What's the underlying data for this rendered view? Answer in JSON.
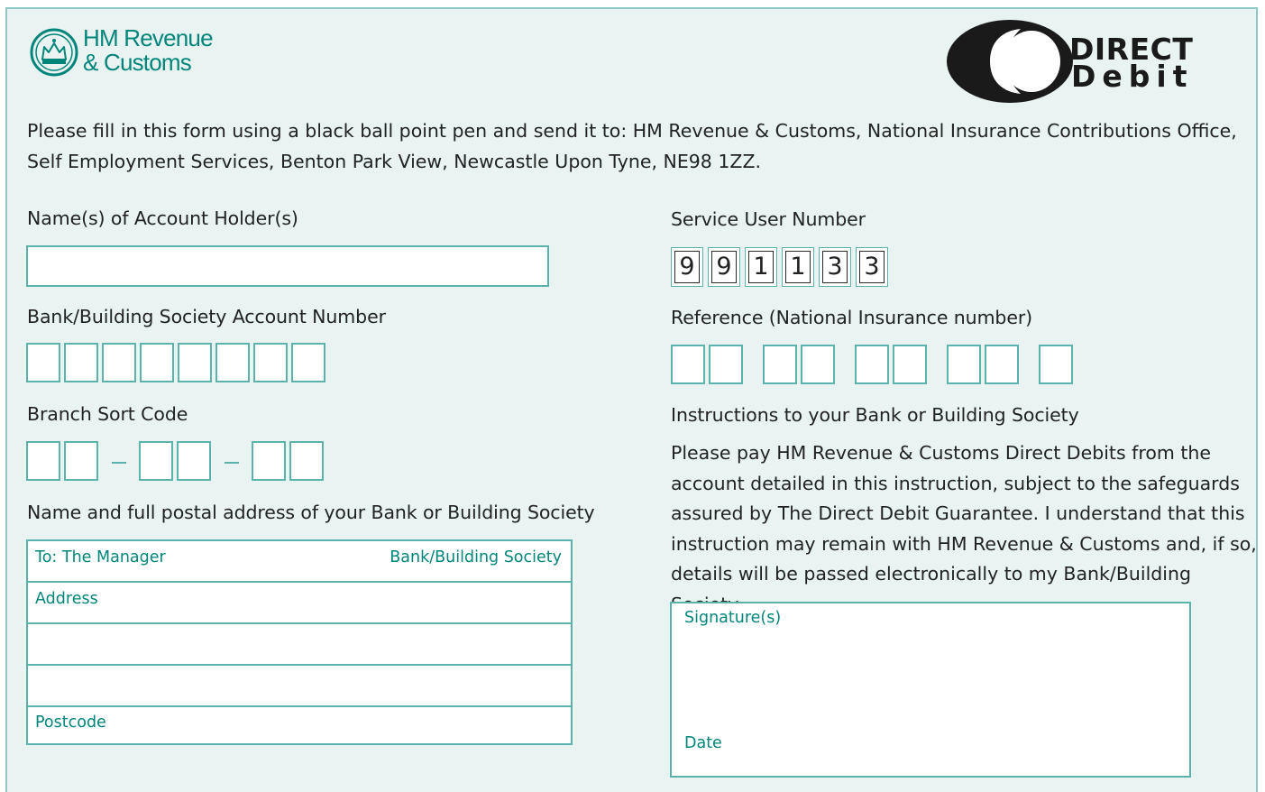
{
  "header": {
    "hmrc_line1": "HM Revenue",
    "hmrc_line2": "& Customs",
    "dd_word1": "DIRECT",
    "dd_word2": "Debit"
  },
  "intro": "Please fill in this form using a black ball point pen and send it to: HM Revenue & Customs, National Insurance Contributions Office, Self Employment Services, Benton Park View, Newcastle Upon Tyne, NE98 1ZZ.",
  "left": {
    "account_holder_label": "Name(s) of Account Holder(s)",
    "account_number_label": "Bank/Building Society Account Number",
    "sort_code_label": "Branch Sort Code",
    "bank_address_label": "Name and full postal address of your Bank or Building Society",
    "to_manager": "To: The Manager",
    "bank_society": "Bank/Building Society",
    "address": "Address",
    "postcode": "Postcode"
  },
  "right": {
    "service_user_label": "Service User Number",
    "service_user_digits": [
      "9",
      "9",
      "1",
      "1",
      "3",
      "3"
    ],
    "reference_label": "Reference (National Insurance number)",
    "instructions_label": "Instructions to your Bank or Building Society",
    "instructions_text": "Please pay HM Revenue & Customs Direct Debits from the account detailed in this instruction, subject to the safeguards assured by The Direct Debit Guarantee. I understand that this instruction may remain with HM Revenue & Customs and, if so, details will be passed electronically to my Bank/Building Society.",
    "signature": "Signature(s)",
    "date": "Date"
  },
  "colors": {
    "teal": "#00857a",
    "border": "#5cb3ab",
    "background": "#e8f3f2"
  }
}
